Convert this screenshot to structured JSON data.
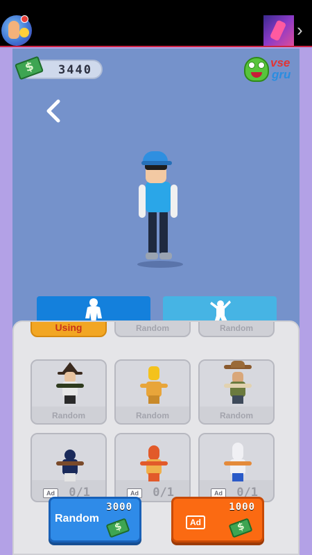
{
  "wallet": {
    "amount": "3440"
  },
  "logo": {
    "line1": "vse",
    "line2": "gru"
  },
  "tabs": [
    {
      "name": "outfits"
    },
    {
      "name": "emotes"
    }
  ],
  "shop": {
    "top_row": [
      {
        "label": "Using",
        "state": "using"
      },
      {
        "label": "Random",
        "state": "locked"
      },
      {
        "label": "Random",
        "state": "locked"
      }
    ],
    "middle_row": [
      {
        "label": "Random",
        "character": "wizard"
      },
      {
        "label": "Random",
        "character": "luchador"
      },
      {
        "label": "Random",
        "character": "cowboy"
      }
    ],
    "bottom_row": [
      {
        "badge": "Ad",
        "progress": "0/1",
        "character": "football-player"
      },
      {
        "badge": "Ad",
        "progress": "0/1",
        "character": "hotdog"
      },
      {
        "badge": "Ad",
        "progress": "0/1",
        "character": "robot"
      }
    ]
  },
  "buttons": {
    "random_label": "Random",
    "random_price": "3000",
    "ad_label": "Ad",
    "ad_reward": "1000"
  },
  "colors": {
    "accent_blue": "#2f8be8",
    "accent_orange": "#fb6a12",
    "using_gold": "#f2a623"
  }
}
